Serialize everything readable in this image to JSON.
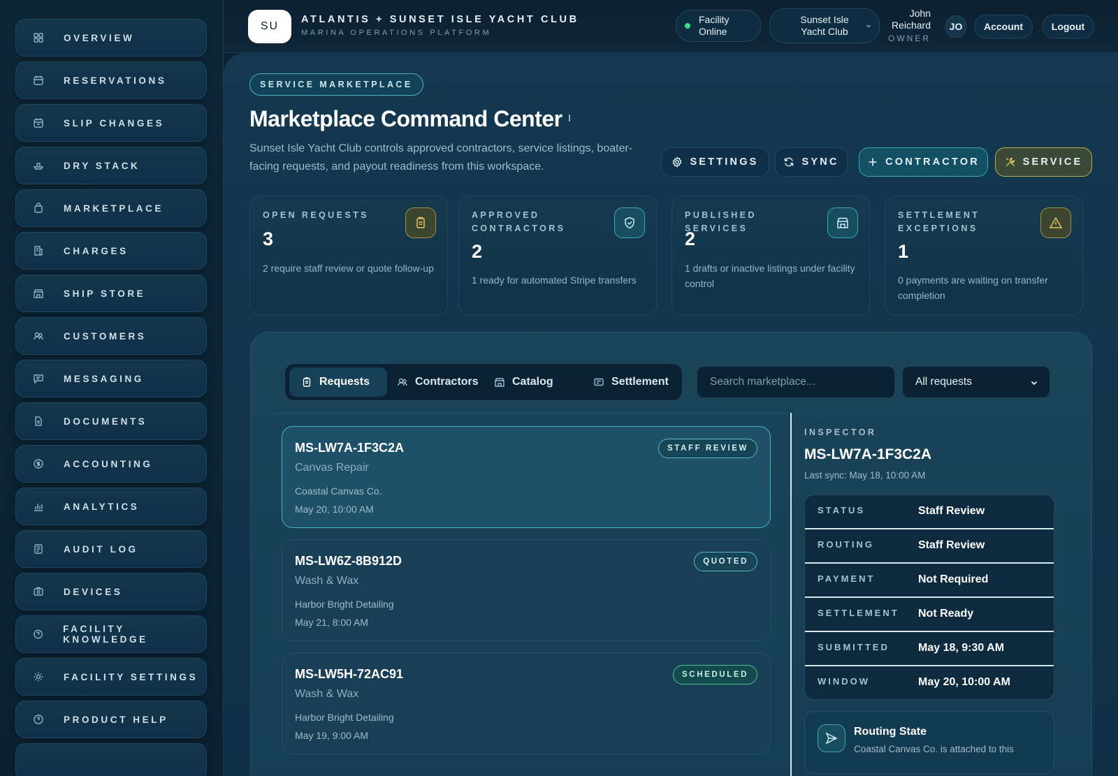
{
  "sidebar": {
    "items": [
      {
        "label": "OVERVIEW",
        "icon": "grid-icon"
      },
      {
        "label": "RESERVATIONS",
        "icon": "calendar-icon"
      },
      {
        "label": "SLIP CHANGES",
        "icon": "calendar-swap-icon"
      },
      {
        "label": "DRY STACK",
        "icon": "boat-icon"
      },
      {
        "label": "MARKETPLACE",
        "icon": "bag-icon"
      },
      {
        "label": "CHARGES",
        "icon": "receipt-icon"
      },
      {
        "label": "SHIP STORE",
        "icon": "store-icon"
      },
      {
        "label": "CUSTOMERS",
        "icon": "users-icon"
      },
      {
        "label": "MESSAGING",
        "icon": "message-icon"
      },
      {
        "label": "DOCUMENTS",
        "icon": "document-icon"
      },
      {
        "label": "ACCOUNTING",
        "icon": "coin-icon"
      },
      {
        "label": "ANALYTICS",
        "icon": "chart-icon"
      },
      {
        "label": "AUDIT LOG",
        "icon": "log-icon"
      },
      {
        "label": "DEVICES",
        "icon": "device-icon"
      },
      {
        "label": "FACILITY KNOWLEDGE",
        "icon": "knowledge-icon"
      },
      {
        "label": "FACILITY SETTINGS",
        "icon": "sun-gear-icon"
      },
      {
        "label": "PRODUCT HELP",
        "icon": "help-icon"
      }
    ]
  },
  "header": {
    "badge": "SU",
    "title": "ATLANTIS + SUNSET ISLE YACHT CLUB",
    "subtitle": "MARINA OPERATIONS PLATFORM",
    "facility_status_line1": "Facility",
    "facility_status_line2": "Online",
    "facility_status_color": "#3ddc84",
    "club_line1": "Sunset Isle",
    "club_line2": "Yacht Club",
    "user_first": "John",
    "user_last": "Reichard",
    "user_role": "OWNER",
    "user_initials": "JO",
    "account_label": "Account",
    "logout_label": "Logout"
  },
  "page": {
    "chip": "SERVICE MARKETPLACE",
    "title": "Marketplace Command Center",
    "description": "Sunset Isle Yacht Club controls approved contractors, service listings, boater-facing requests, and payout readiness from this workspace.",
    "actions": {
      "settings": "SETTINGS",
      "sync": "SYNC",
      "contractor": "CONTRACTOR",
      "service": "SERVICE"
    }
  },
  "stats": [
    {
      "label": "OPEN REQUESTS",
      "value": "3",
      "note": "2 require staff review or quote follow-up"
    },
    {
      "label": "APPROVED CONTRACTORS",
      "value": "2",
      "note": "1 ready for automated Stripe transfers"
    },
    {
      "label": "PUBLISHED SERVICES",
      "value": "2",
      "note": "1 drafts or inactive listings under facility control"
    },
    {
      "label": "SETTLEMENT EXCEPTIONS",
      "value": "1",
      "note": "0 payments are waiting on transfer completion"
    }
  ],
  "workspace": {
    "tabs": {
      "requests": "Requests",
      "contractors": "Contractors",
      "catalog": "Catalog",
      "settlement": "Settlement"
    },
    "search_placeholder": "Search marketplace...",
    "filter_value": "All requests",
    "requests": [
      {
        "id": "MS-LW7A-1F3C2A",
        "service": "Canvas Repair",
        "vendor": "Coastal Canvas Co.",
        "date": "May 20, 10:00 AM",
        "status": "STAFF REVIEW"
      },
      {
        "id": "MS-LW6Z-8B912D",
        "service": "Wash & Wax",
        "vendor": "Harbor Bright Detailing",
        "date": "May 21, 8:00 AM",
        "status": "QUOTED"
      },
      {
        "id": "MS-LW5H-72AC91",
        "service": "Wash & Wax",
        "vendor": "Harbor Bright Detailing",
        "date": "May 19, 9:00 AM",
        "status": "SCHEDULED"
      }
    ],
    "inspector": {
      "label": "INSPECTOR",
      "id": "MS-LW7A-1F3C2A",
      "last_sync": "Last sync: May 18, 10:00 AM",
      "rows": [
        {
          "key": "STATUS",
          "value": "Staff Review"
        },
        {
          "key": "ROUTING",
          "value": "Staff Review"
        },
        {
          "key": "PAYMENT",
          "value": "Not Required"
        },
        {
          "key": "SETTLEMENT",
          "value": "Not Ready"
        },
        {
          "key": "SUBMITTED",
          "value": "May 18, 9:30 AM"
        },
        {
          "key": "WINDOW",
          "value": "May 20, 10:00 AM"
        }
      ],
      "routing_title": "Routing State",
      "routing_text": "Coastal Canvas Co. is attached to this"
    }
  }
}
